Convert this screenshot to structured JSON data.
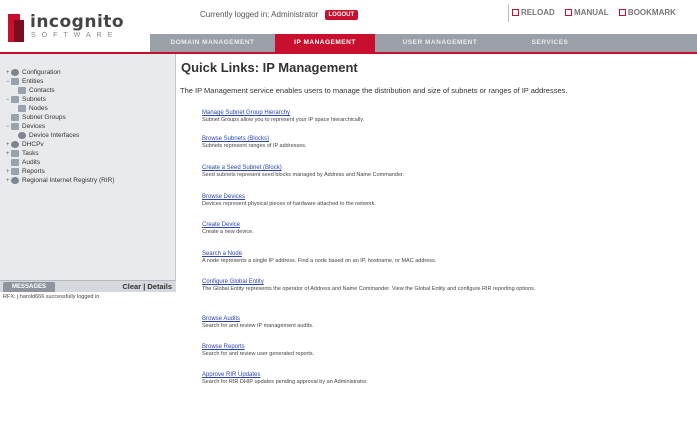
{
  "brand": {
    "name": "incognito",
    "tagline": "SOFTWARE"
  },
  "topbar": {
    "logged_in_text": "Currently logged in: Administrator",
    "logout_label": "LOGOUT"
  },
  "toplinks": {
    "reload": "RELOAD",
    "manual": "MANUAL",
    "bookmark": "BOOKMARK"
  },
  "tabs": [
    {
      "label": "DOMAIN MANAGEMENT"
    },
    {
      "label": "IP MANAGEMENT"
    },
    {
      "label": "USER MANAGEMENT"
    },
    {
      "label": "SERVICES"
    }
  ],
  "tree": [
    {
      "label": "Configuration",
      "indent": 0
    },
    {
      "label": "Entities",
      "indent": 0
    },
    {
      "label": "Contacts",
      "indent": 1
    },
    {
      "label": "Subnets",
      "indent": 0
    },
    {
      "label": "Nodes",
      "indent": 1
    },
    {
      "label": "Subnet Groups",
      "indent": 0
    },
    {
      "label": "Devices",
      "indent": 0
    },
    {
      "label": "Device Interfaces",
      "indent": 1
    },
    {
      "label": "DHCPv",
      "indent": 0
    },
    {
      "label": "Tasks",
      "indent": 0
    },
    {
      "label": "Audits",
      "indent": 0
    },
    {
      "label": "Reports",
      "indent": 0
    },
    {
      "label": "Regional Internet Registry (RIR)",
      "indent": 0
    }
  ],
  "messages": {
    "tab_label": "MESSAGES",
    "clear": "Clear",
    "separator": "|",
    "details": "Details",
    "body": "RFX: j.harold666 successfully logged in"
  },
  "main": {
    "title": "Quick Links: IP Management",
    "intro": "The IP Management service enables users to manage the distribution and size of subnets or ranges of IP addresses.",
    "links": [
      {
        "title": "Manage Subnet Group Hierarchy",
        "desc": "Subnet Groups allow you to represent your IP space hierarchically."
      },
      {
        "title": "Browse Subnets (Blocks)",
        "desc": "Subnets represent ranges of IP addresses."
      },
      {
        "title": "Create a Seed Subnet (Block)",
        "desc": "Seed subnets represent seed blocks managed by Address and Name Commander."
      },
      {
        "title": "Browse Devices",
        "desc": "Devices represent physical pieces of hardware attached to the network."
      },
      {
        "title": "Create Device",
        "desc": "Create a new device."
      },
      {
        "title": "Search a Node",
        "desc": "A node represents a single IP address. Find a node based on an IP, hostname, or MAC address."
      },
      {
        "title": "Configure Global Entity",
        "desc": "The Global Entity represents the operator of Address and Name Commander. View the Global Entity and configure RIR reporting options."
      },
      {
        "title": "Browse Audits",
        "desc": "Search for and review IP management audits."
      },
      {
        "title": "Browse Reports",
        "desc": "Search for and review user generated reports."
      },
      {
        "title": "Approve RIR Updates",
        "desc": "Search for RIR DHIP updates pending approval by an Administrator."
      }
    ]
  }
}
